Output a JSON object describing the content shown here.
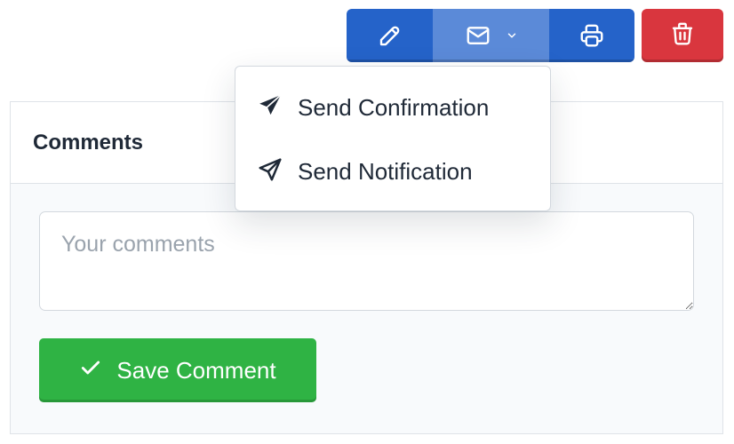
{
  "toolbar": {
    "icons": {
      "edit": "pencil-icon",
      "email": "envelope-icon",
      "email_caret": "chevron-down-icon",
      "print": "printer-icon",
      "delete": "trash-icon"
    },
    "colors": {
      "primary": "#2563c9",
      "primary_active": "#5b8ad8",
      "danger": "#d9363e"
    }
  },
  "email_menu": {
    "items": [
      {
        "label": "Send Confirmation",
        "icon": "paper-plane-filled-icon"
      },
      {
        "label": "Send Notification",
        "icon": "paper-plane-outline-icon"
      }
    ]
  },
  "comments": {
    "title": "Comments",
    "textarea": {
      "value": "",
      "placeholder": "Your comments"
    },
    "save_button": {
      "label": "Save Comment",
      "icon": "check-icon",
      "color": "#2fb344"
    }
  }
}
